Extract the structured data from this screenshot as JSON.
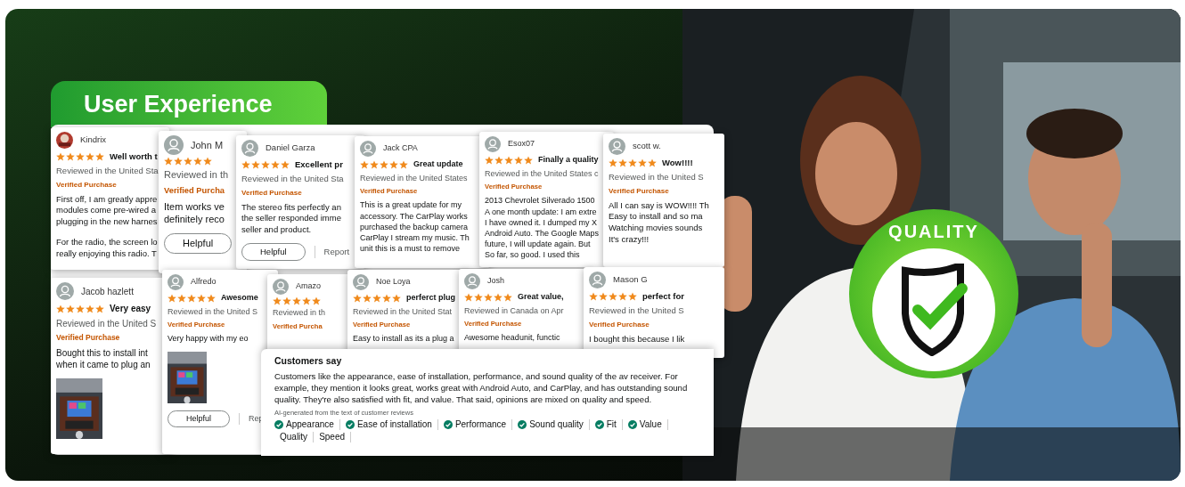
{
  "section_title": "User Experience",
  "reviews": [
    {
      "name": "Kindrix",
      "avatar": {
        "kind": "picture"
      },
      "stars": 5,
      "title": "Well worth t",
      "location": "Reviewed in the United Sta",
      "badge": "Verified Purchase",
      "paragraphs": [
        [
          "First off, I am greatly appre",
          "modules come pre-wired a",
          "plugging in the new harnes"
        ],
        [
          "For the radio, the screen lo",
          "really enjoying this radio. T"
        ]
      ]
    },
    {
      "name": "John M",
      "stars": 5,
      "location": "Reviewed in th",
      "badge": "Verified Purcha",
      "paragraphs": [
        [
          "Item works ve",
          "definitely reco"
        ]
      ],
      "actions": [
        "Helpful"
      ]
    },
    {
      "name": "Daniel Garza",
      "stars": 5,
      "title": "Excellent pr",
      "location": "Reviewed in the United Sta",
      "badge": "Verified Purchase",
      "paragraphs": [
        [
          "The stereo fits perfectly an",
          "the seller responded imme",
          "seller and product."
        ]
      ],
      "actions": [
        "Helpful",
        "Report"
      ]
    },
    {
      "name": "Jack CPA",
      "stars": 5,
      "title": "Great update",
      "location": "Reviewed in the United States",
      "badge": "Verified Purchase",
      "paragraphs": [
        [
          "This is a great update for my",
          "accessory. The CarPlay works",
          "purchased the backup camera",
          "CarPlay I stream my music. Th",
          "unit this is a must to remove"
        ]
      ]
    },
    {
      "name": "Esox07",
      "stars": 5,
      "title": "Finally a quality",
      "location": "Reviewed in the United States c",
      "badge": "Verified Purchase",
      "paragraphs": [
        [
          "2013 Chevrolet Silverado 1500",
          "A one month update: I am extre",
          "I have owned it. I dumped my X",
          "Android Auto. The Google Maps",
          "future, I will update again. But",
          "So far, so good. I used this"
        ]
      ]
    },
    {
      "name": "scott w.",
      "stars": 5,
      "title": "Wow!!!!",
      "location": "Reviewed in the United S",
      "badge": "Verified Purchase",
      "paragraphs": [
        [
          "All I can say is WOW!!!! Th",
          "Easy to install and so ma",
          "Watching movies sounds",
          "It's crazy!!!"
        ]
      ]
    },
    {
      "name": "Jacob hazlett",
      "stars": 5,
      "title": "Very easy",
      "location": "Reviewed in the United S",
      "badge": "Verified Purchase",
      "paragraphs": [
        [
          "Bought this to install int",
          "when it came to plug an"
        ]
      ],
      "photo": {
        "kind": "picture"
      }
    },
    {
      "name": "Alfredo",
      "stars": 5,
      "title": "Awesome",
      "location": "Reviewed in the United S",
      "badge": "Verified Purchase",
      "paragraphs": [
        [
          "Very happy with my eo"
        ]
      ],
      "photo": {
        "kind": "picture"
      },
      "actions": [
        "Helpful",
        "Rep"
      ]
    },
    {
      "name": "Amazo",
      "stars": 5,
      "location": "Reviewed in th",
      "badge": "Verified Purcha"
    },
    {
      "name": "Noe Loya",
      "stars": 5,
      "title": "perferct plug",
      "location": "Reviewed in the United Stat",
      "badge": "Verified Purchase",
      "paragraphs": [
        [
          "Easy to install as its a plug a"
        ]
      ]
    },
    {
      "name": "Josh",
      "stars": 5,
      "title": "Great value,",
      "location": "Reviewed in Canada on Apr",
      "badge": "Verified Purchase",
      "paragraphs": [
        [
          "Awesome headunit, functic"
        ]
      ]
    },
    {
      "name": "Mason G",
      "stars": 5,
      "title": "perfect for",
      "location": "Reviewed in the United S",
      "badge": "Verified Purchase",
      "paragraphs": [
        [
          "I bought this because I lik"
        ]
      ]
    }
  ],
  "customers_say": {
    "title": "Customers say",
    "summary": "Customers like the appearance, ease of installation, performance, and sound quality of the av receiver. For example, they mention it looks great, works great with Android Auto, and CarPlay, and has outstanding sound quality. They're also satisfied with fit, and value. That said, opinions are mixed on quality and speed.",
    "note": "AI-generated from the text of customer reviews",
    "aspects": [
      {
        "label": "Appearance",
        "positive": true
      },
      {
        "label": "Ease of installation",
        "positive": true
      },
      {
        "label": "Performance",
        "positive": true
      },
      {
        "label": "Sound quality",
        "positive": true
      },
      {
        "label": "Fit",
        "positive": true
      },
      {
        "label": "Value",
        "positive": true
      },
      {
        "label": "Quality",
        "positive": false
      },
      {
        "label": "Speed",
        "positive": false
      }
    ]
  },
  "badge": {
    "label": "QUALITY"
  }
}
